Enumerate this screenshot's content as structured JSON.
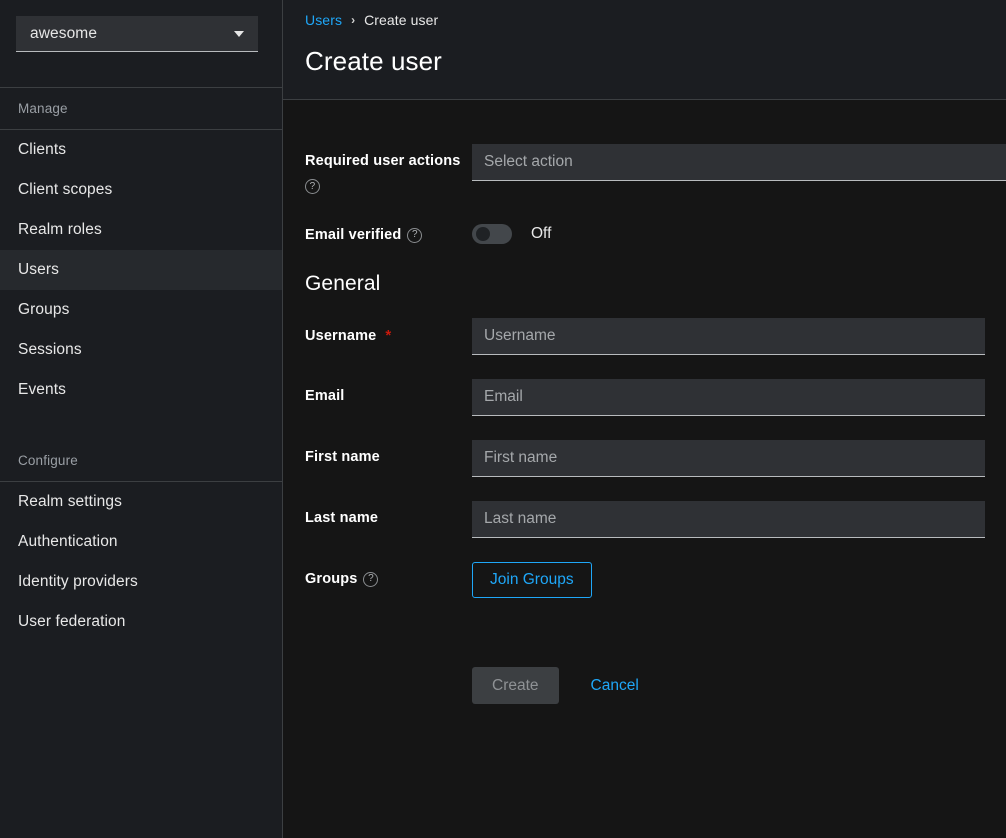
{
  "sidebar": {
    "realm_selector": {
      "value": "awesome",
      "caret_icon": "chevron-down-icon"
    },
    "sections": [
      {
        "title": "Manage",
        "items": [
          {
            "label": "Clients",
            "active": false
          },
          {
            "label": "Client scopes",
            "active": false
          },
          {
            "label": "Realm roles",
            "active": false
          },
          {
            "label": "Users",
            "active": true
          },
          {
            "label": "Groups",
            "active": false
          },
          {
            "label": "Sessions",
            "active": false
          },
          {
            "label": "Events",
            "active": false
          }
        ]
      },
      {
        "title": "Configure",
        "items": [
          {
            "label": "Realm settings",
            "active": false
          },
          {
            "label": "Authentication",
            "active": false
          },
          {
            "label": "Identity providers",
            "active": false
          },
          {
            "label": "User federation",
            "active": false
          }
        ]
      }
    ]
  },
  "header": {
    "breadcrumb": {
      "parent": "Users",
      "separator": "›",
      "current": "Create user"
    },
    "title": "Create user"
  },
  "form": {
    "required_user_actions": {
      "label": "Required user actions",
      "placeholder": "Select action",
      "value": "",
      "help_icon": "help-circle-icon"
    },
    "email_verified": {
      "label": "Email verified",
      "help_icon": "help-circle-icon",
      "state_text": "Off",
      "enabled": false
    },
    "general_heading": "General",
    "username": {
      "label": "Username",
      "required_marker": "*",
      "placeholder": "Username",
      "value": ""
    },
    "email": {
      "label": "Email",
      "placeholder": "Email",
      "value": ""
    },
    "first_name": {
      "label": "First name",
      "placeholder": "First name",
      "value": ""
    },
    "last_name": {
      "label": "Last name",
      "placeholder": "Last name",
      "value": ""
    },
    "groups": {
      "label": "Groups",
      "help_icon": "help-circle-icon",
      "button_label": "Join Groups"
    },
    "actions": {
      "submit_label": "Create",
      "submit_disabled": true,
      "cancel_label": "Cancel"
    }
  },
  "colors": {
    "accent_blue": "#1fa7f8",
    "required_red": "#c9190b",
    "sidebar_bg": "#1b1d21",
    "main_bg": "#151515",
    "input_bg": "#2f3135",
    "active_nav_bg": "#26292d"
  }
}
